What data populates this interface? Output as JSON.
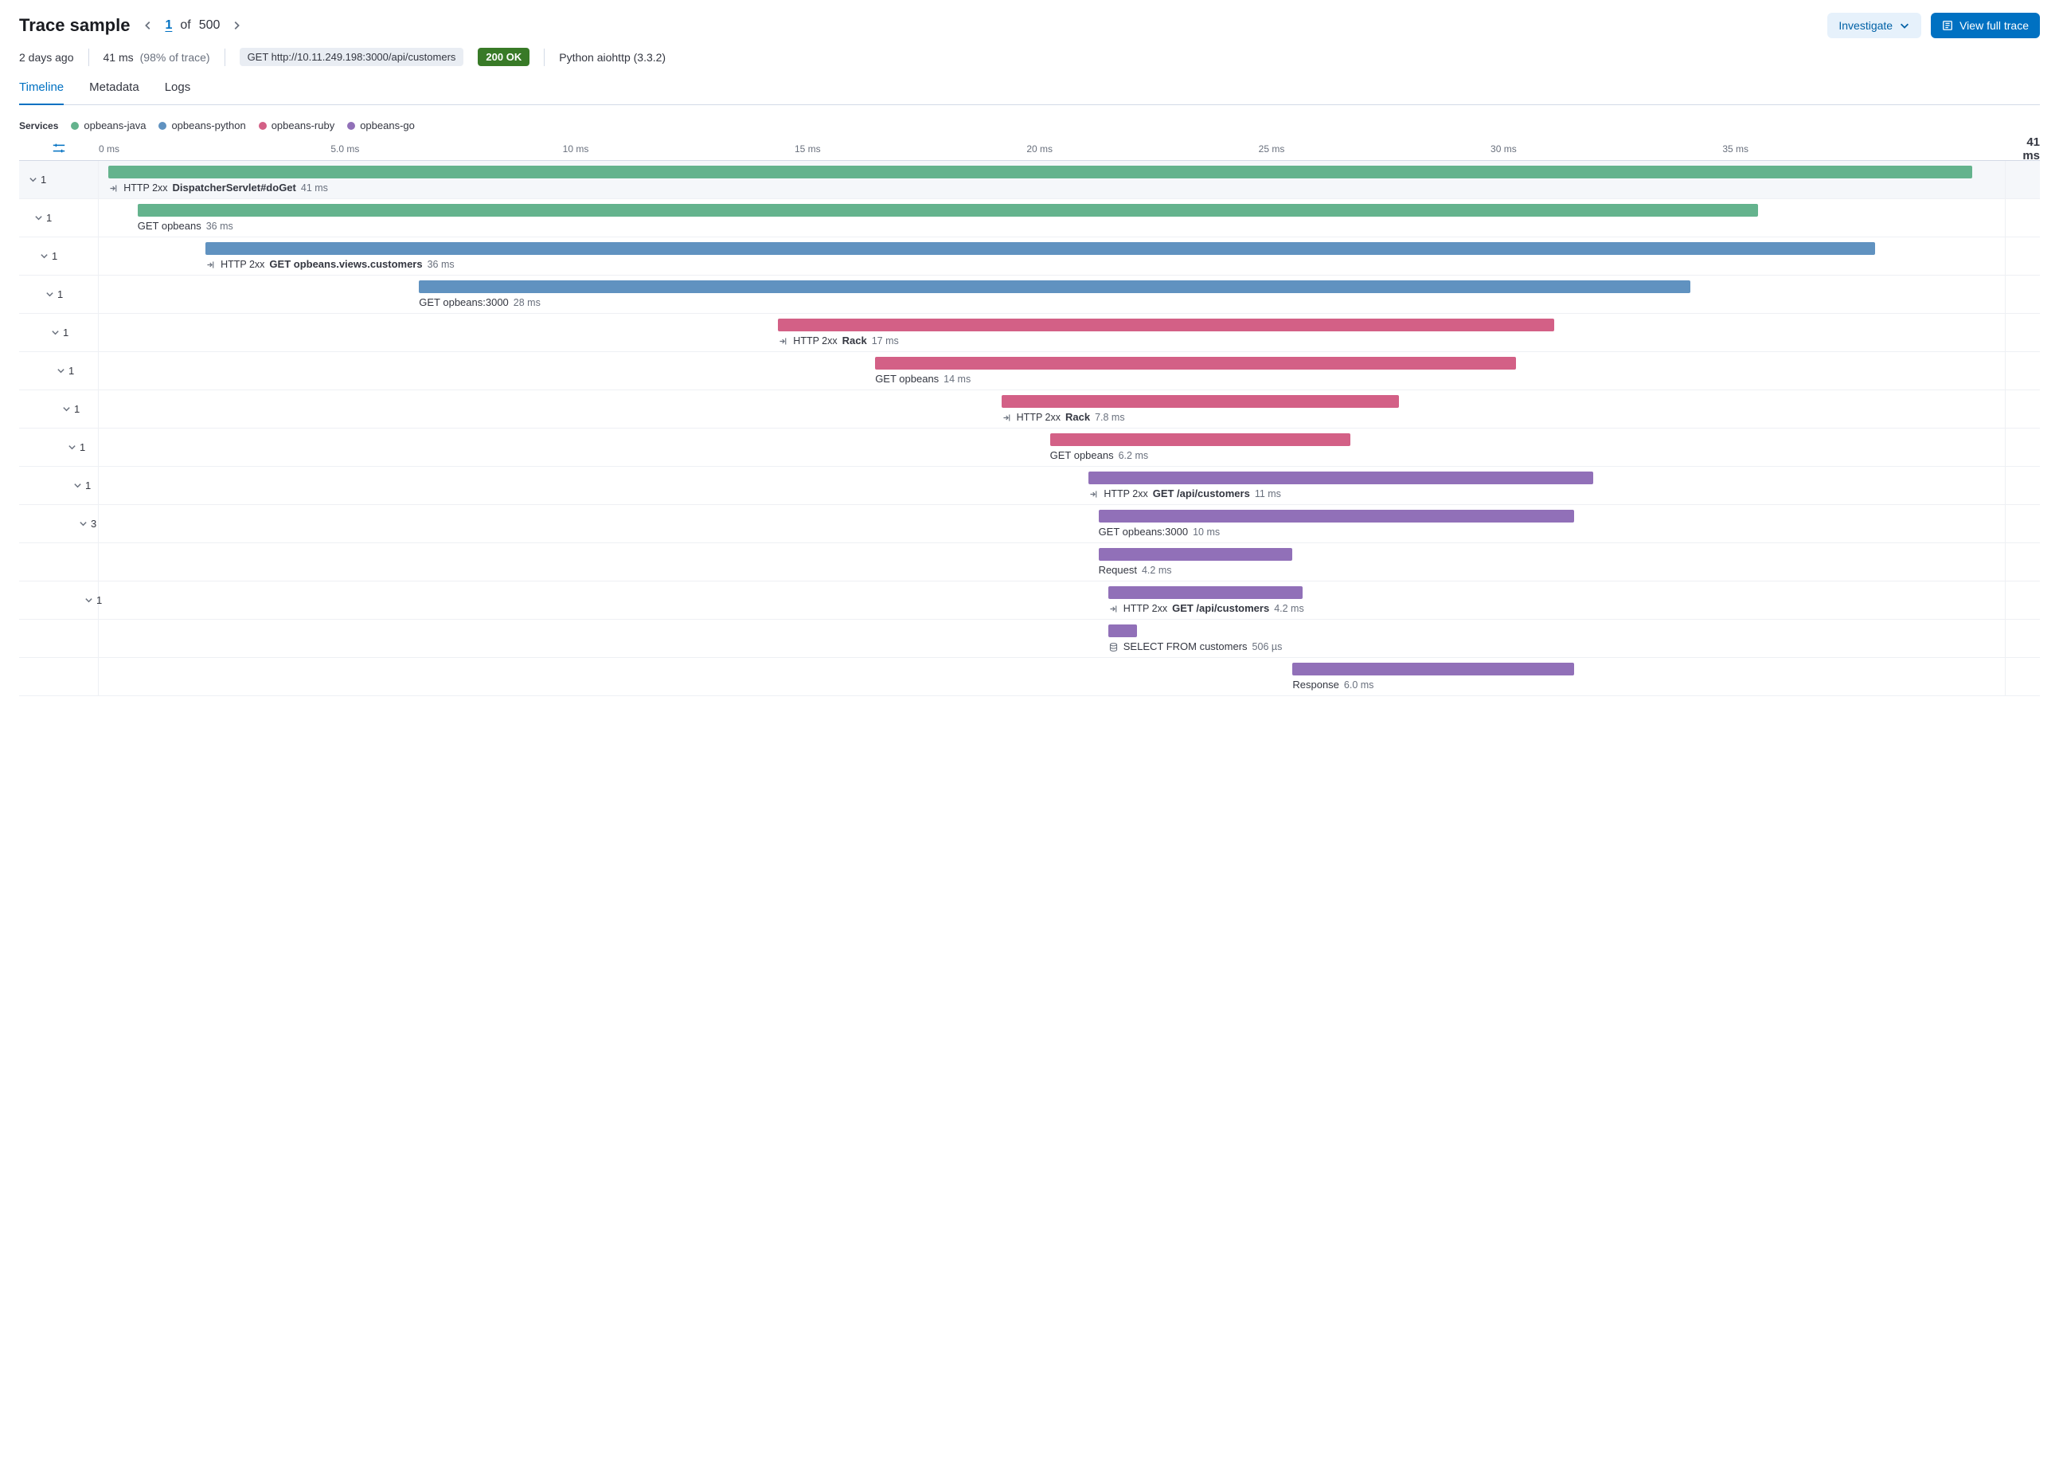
{
  "header": {
    "title": "Trace sample",
    "pager": {
      "current": "1",
      "word_of": "of",
      "total": "500"
    },
    "buttons": {
      "investigate": "Investigate",
      "view_full_trace": "View full trace"
    }
  },
  "meta": {
    "age": "2 days ago",
    "duration": "41 ms",
    "pct_of_trace": "(98% of trace)",
    "request_pill": "GET http://10.11.249.198:3000/api/customers",
    "status_pill": "200 OK",
    "agent": "Python aiohttp (3.3.2)"
  },
  "tabs": [
    {
      "id": "timeline",
      "label": "Timeline",
      "active": true
    },
    {
      "id": "metadata",
      "label": "Metadata",
      "active": false
    },
    {
      "id": "logs",
      "label": "Logs",
      "active": false
    }
  ],
  "legend": {
    "label": "Services",
    "items": [
      {
        "name": "opbeans-java",
        "color": "green"
      },
      {
        "name": "opbeans-python",
        "color": "blue"
      },
      {
        "name": "opbeans-ruby",
        "color": "pink"
      },
      {
        "name": "opbeans-go",
        "color": "purple"
      }
    ]
  },
  "axis": {
    "ticks": [
      {
        "label": "0 ms",
        "pct": 0
      },
      {
        "label": "5.0 ms",
        "pct": 12.2
      },
      {
        "label": "10 ms",
        "pct": 24.4
      },
      {
        "label": "15 ms",
        "pct": 36.6
      },
      {
        "label": "20 ms",
        "pct": 48.8
      },
      {
        "label": "25 ms",
        "pct": 61.0
      },
      {
        "label": "30 ms",
        "pct": 73.2
      },
      {
        "label": "35 ms",
        "pct": 85.4
      }
    ],
    "end_label": "41 ms"
  },
  "spans": [
    {
      "depth": 0,
      "count": "1",
      "color": "green",
      "left": 0.5,
      "width": 96.0,
      "top": true,
      "icon": "incoming",
      "http": "HTTP 2xx",
      "name": "DispatcherServlet#doGet",
      "bold": true,
      "duration": "41 ms"
    },
    {
      "depth": 1,
      "count": "1",
      "color": "green",
      "left": 2.0,
      "width": 83.5,
      "icon": null,
      "http": null,
      "name": "GET opbeans",
      "bold": false,
      "duration": "36 ms"
    },
    {
      "depth": 2,
      "count": "1",
      "color": "blue",
      "left": 5.5,
      "width": 86.0,
      "icon": "incoming",
      "http": "HTTP 2xx",
      "name": "GET opbeans.views.customers",
      "bold": true,
      "duration": "36 ms"
    },
    {
      "depth": 3,
      "count": "1",
      "color": "blue",
      "left": 16.5,
      "width": 65.5,
      "icon": null,
      "http": null,
      "name": "GET opbeans:3000",
      "bold": false,
      "duration": "28 ms"
    },
    {
      "depth": 4,
      "count": "1",
      "color": "pink",
      "left": 35.0,
      "width": 40.0,
      "icon": "incoming",
      "http": "HTTP 2xx",
      "name": "Rack",
      "bold": true,
      "duration": "17 ms"
    },
    {
      "depth": 5,
      "count": "1",
      "color": "pink",
      "left": 40.0,
      "width": 33.0,
      "icon": null,
      "http": null,
      "name": "GET opbeans",
      "bold": false,
      "duration": "14 ms"
    },
    {
      "depth": 6,
      "count": "1",
      "color": "pink",
      "left": 46.5,
      "width": 20.5,
      "icon": "incoming",
      "http": "HTTP 2xx",
      "name": "Rack",
      "bold": true,
      "duration": "7.8 ms"
    },
    {
      "depth": 7,
      "count": "1",
      "color": "pink",
      "left": 49.0,
      "width": 15.5,
      "icon": null,
      "http": null,
      "name": "GET opbeans",
      "bold": false,
      "duration": "6.2 ms"
    },
    {
      "depth": 8,
      "count": "1",
      "color": "purple",
      "left": 51.0,
      "width": 26.0,
      "icon": "incoming",
      "http": "HTTP 2xx",
      "name": "GET /api/customers",
      "bold": true,
      "duration": "11 ms"
    },
    {
      "depth": 9,
      "count": "3",
      "color": "purple",
      "left": 51.5,
      "width": 24.5,
      "icon": null,
      "http": null,
      "name": "GET opbeans:3000",
      "bold": false,
      "duration": "10 ms"
    },
    {
      "depth": 9,
      "count": "",
      "color": "purple",
      "left": 51.5,
      "width": 10.0,
      "icon": null,
      "http": null,
      "name": "Request",
      "bold": false,
      "duration": "4.2 ms"
    },
    {
      "depth": 10,
      "count": "1",
      "color": "purple",
      "left": 52.0,
      "width": 10.0,
      "icon": "incoming",
      "http": "HTTP 2xx",
      "name": "GET /api/customers",
      "bold": true,
      "duration": "4.2 ms"
    },
    {
      "depth": 10,
      "count": "",
      "color": "purple",
      "left": 52.0,
      "width": 1.5,
      "icon": "db",
      "http": null,
      "name": "SELECT FROM customers",
      "bold": false,
      "duration": "506 µs"
    },
    {
      "depth": 9,
      "count": "",
      "color": "purple",
      "left": 61.5,
      "width": 14.5,
      "icon": null,
      "http": null,
      "name": "Response",
      "bold": false,
      "duration": "6.0 ms"
    }
  ]
}
